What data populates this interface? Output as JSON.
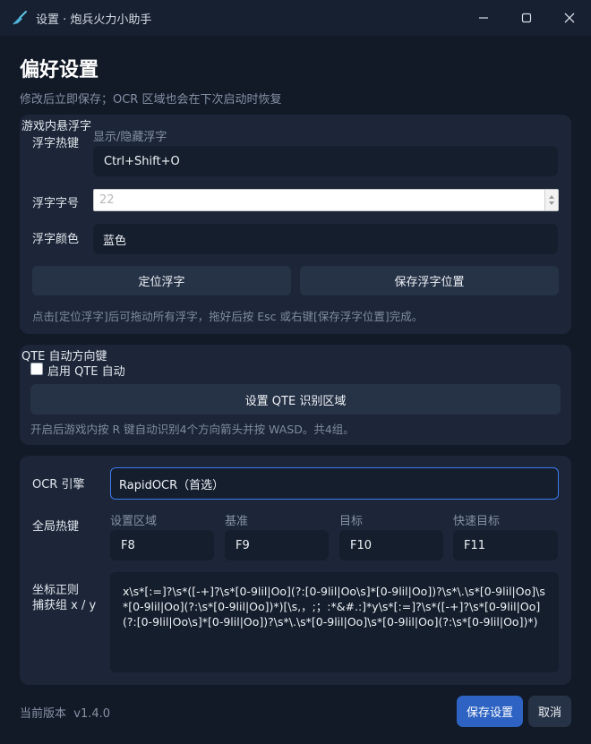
{
  "window": {
    "title": "设置 · 炮兵火力小助手",
    "icon": "broom-icon",
    "controls": [
      "minimize-icon",
      "maximize-icon",
      "close-icon"
    ]
  },
  "header": {
    "title": "偏好设置",
    "subtitle": "修改后立即保存；OCR 区域也会在下次启动时恢复"
  },
  "overlay_section": {
    "heading": "游戏内悬浮字",
    "hotkey_label": "浮字热键",
    "hotkey_caption": "显示/隐藏浮字",
    "hotkey_value": "Ctrl+Shift+O",
    "font_size_label": "浮字字号",
    "font_size_value": "22",
    "color_label": "浮字颜色",
    "color_value": "蓝色",
    "locate_button": "定位浮字",
    "save_position_button": "保存浮字位置",
    "hint": "点击[定位浮字]后可拖动所有浮字，拖好后按 Esc 或右键[保存浮字位置]完成。"
  },
  "qte_section": {
    "heading": "QTE 自动方向键",
    "enable_label": "启用 QTE 自动",
    "enable_checked": false,
    "region_button": "设置 QTE 识别区域",
    "hint": "开启后游戏内按 R 键自动识别4个方向箭头并按 WASD。共4组。"
  },
  "ocr_section": {
    "engine_label": "OCR 引擎",
    "engine_value": "RapidOCR（首选）",
    "hotkeys_label": "全局热键",
    "hotkeys": [
      {
        "caption": "设置区域",
        "value": "F8"
      },
      {
        "caption": "基准",
        "value": "F9"
      },
      {
        "caption": "目标",
        "value": "F10"
      },
      {
        "caption": "快速目标",
        "value": "F11"
      }
    ],
    "regex_label_line1": "坐标正则",
    "regex_label_line2": "捕获组 x / y",
    "regex_value": "x\\s*[:=]?\\s*([-+]?\\s*[0-9lil|Oo](?:[0-9lil|Oo\\s]*[0-9lil|Oo])?\\s*\\.\\s*[0-9lil|Oo]\\s*[0-9lil|Oo](?:\\s*[0-9lil|Oo])*)[\\s,，;；:*&#.:]*y\\s*[:=]?\\s*([-+]?\\s*[0-9lil|Oo](?:[0-9lil|Oo\\s]*[0-9lil|Oo])?\\s*\\.\\s*[0-9lil|Oo]\\s*[0-9lil|Oo](?:\\s*[0-9lil|Oo])*)"
  },
  "footer": {
    "version_label": "当前版本",
    "version_value": "v1.4.0",
    "save_button": "保存设置",
    "cancel_button": "取消"
  }
}
